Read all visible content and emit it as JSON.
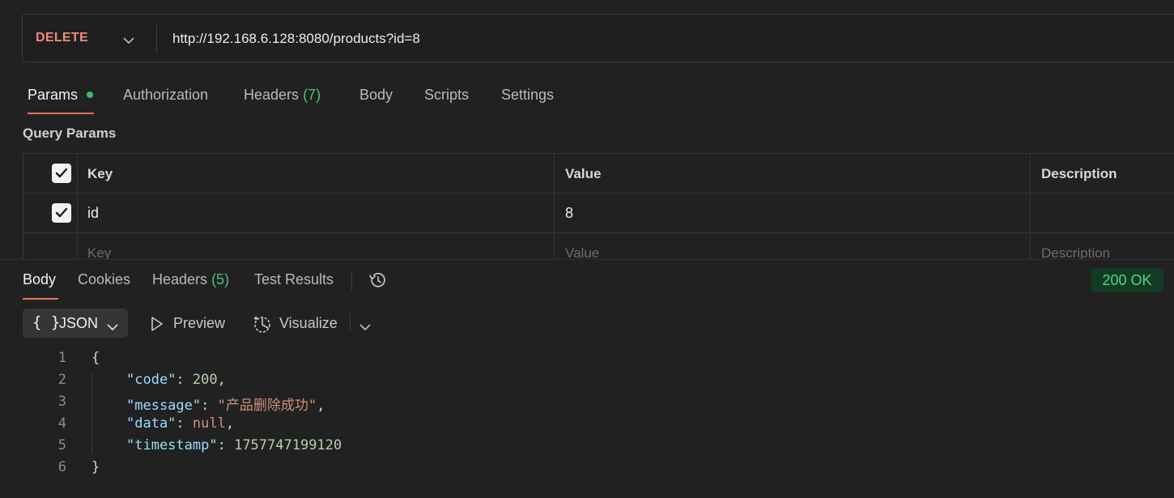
{
  "request": {
    "method": "DELETE",
    "url": "http://192.168.6.128:8080/products?id=8"
  },
  "request_tabs": [
    {
      "label": "Params",
      "active": true,
      "has_dot": true
    },
    {
      "label": "Authorization"
    },
    {
      "label": "Headers",
      "count": "(7)"
    },
    {
      "label": "Body"
    },
    {
      "label": "Scripts"
    },
    {
      "label": "Settings"
    }
  ],
  "query_params": {
    "title": "Query Params",
    "headers": {
      "key": "Key",
      "value": "Value",
      "description": "Description"
    },
    "rows": [
      {
        "checked": true,
        "key": "id",
        "value": "8",
        "description": ""
      }
    ],
    "placeholders": {
      "key": "Key",
      "value": "Value",
      "description": "Description"
    }
  },
  "response_tabs": [
    {
      "label": "Body",
      "active": true
    },
    {
      "label": "Cookies"
    },
    {
      "label": "Headers",
      "count": "(5)"
    },
    {
      "label": "Test Results"
    }
  ],
  "response_status": "200 OK",
  "response_format": {
    "braces": "{ }",
    "selected": "JSON",
    "preview_label": "Preview",
    "visualize_label": "Visualize"
  },
  "response_body": {
    "line_numbers": [
      "1",
      "2",
      "3",
      "4",
      "5",
      "6"
    ],
    "open_brace": "{",
    "close_brace": "}",
    "fields": [
      {
        "key": "\"code\"",
        "value": "200"
      },
      {
        "key": "\"message\"",
        "value": "\"产品删除成功\""
      },
      {
        "key": "\"data\"",
        "value": "null"
      },
      {
        "key": "\"timestamp\"",
        "value": "1757747199120"
      }
    ]
  },
  "icons": {
    "method_dropdown": "chevron-down-icon",
    "history": "history-icon",
    "preview": "play-outline-icon",
    "visualize": "visualize-icon",
    "checkbox": "checkmark-icon"
  },
  "colors": {
    "method": "#f08a7c",
    "accent_underline": "#e8735a",
    "status_ok": "#4fd98a",
    "count_green": "#4fc07a"
  }
}
